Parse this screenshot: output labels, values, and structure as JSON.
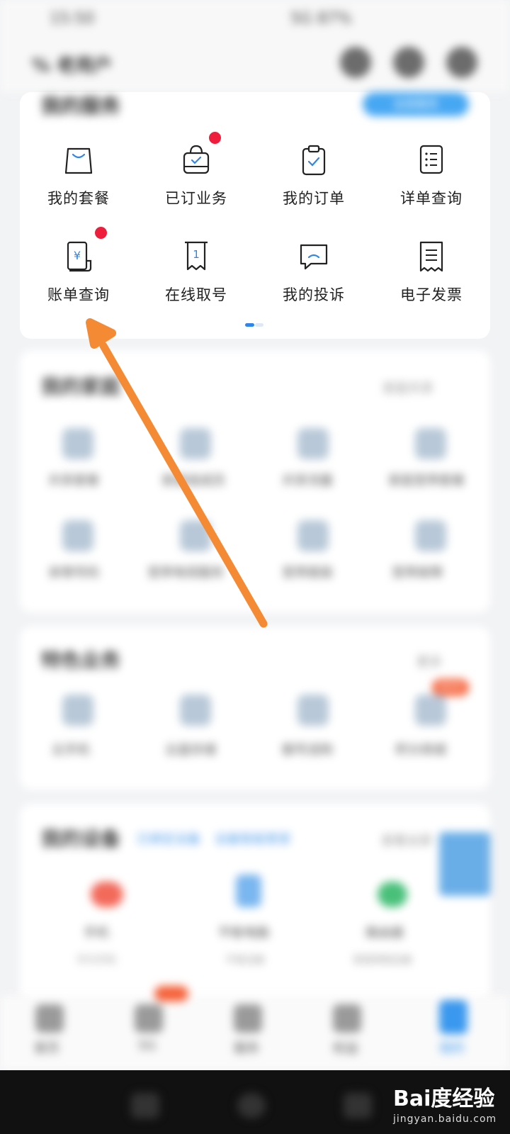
{
  "status": {
    "time": "15:50",
    "right": "5G 87%"
  },
  "header": {
    "title": "% 老用户"
  },
  "services": {
    "title": "我的服务",
    "button": "全部服务",
    "items": [
      {
        "label": "我的套餐",
        "icon": "shopping-bag-icon",
        "badge": false
      },
      {
        "label": "已订业务",
        "icon": "subscribed-bag-icon",
        "badge": true
      },
      {
        "label": "我的订单",
        "icon": "clipboard-check-icon",
        "badge": false
      },
      {
        "label": "详单查询",
        "icon": "list-document-icon",
        "badge": false
      },
      {
        "label": "账单查询",
        "icon": "bill-yuan-icon",
        "badge": true
      },
      {
        "label": "在线取号",
        "icon": "queue-ticket-icon",
        "badge": false
      },
      {
        "label": "我的投诉",
        "icon": "complaint-chat-icon",
        "badge": false
      },
      {
        "label": "电子发票",
        "icon": "invoice-icon",
        "badge": false
      }
    ],
    "pager": {
      "pages": 2,
      "current": 1
    }
  },
  "family": {
    "title": "我的家庭",
    "link": "家庭共享",
    "items": [
      "共享套餐",
      "家庭组成员",
      "共享流量",
      "家庭宽带套餐",
      "亲情号码",
      "宽带电视服务",
      "宽带报装",
      "宽带故障"
    ]
  },
  "featured": {
    "title": "特色业务",
    "link": "更多",
    "badge": "NEW",
    "items": [
      "云手机",
      "云盘存储",
      "靓号选购",
      "积分商城"
    ]
  },
  "devices": {
    "title": "我的设备",
    "tags": [
      "已绑定设备",
      "设备智能管家"
    ],
    "link": "查看全部",
    "items": [
      {
        "label": "手机",
        "sub": "华为手机"
      },
      {
        "label": "平板电脑",
        "sub": "平板设备"
      },
      {
        "label": "路由器",
        "sub": "家庭网络设备"
      }
    ]
  },
  "bottom_nav": {
    "items": [
      "首页",
      "5G",
      "服务",
      "权益",
      "我的"
    ],
    "active": 4
  },
  "watermark": {
    "logo": "Bai度经验",
    "url": "jingyan.baidu.com"
  },
  "colors": {
    "accent": "#2f86e8",
    "badge": "#ef1d3c",
    "arrow": "#f58a34"
  }
}
